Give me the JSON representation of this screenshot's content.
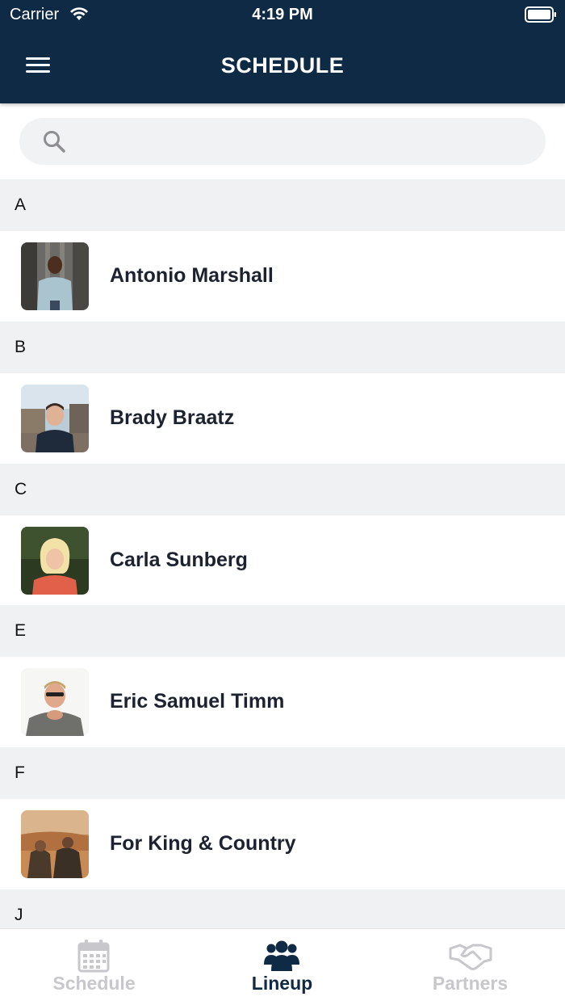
{
  "status_bar": {
    "carrier": "Carrier",
    "time": "4:19 PM"
  },
  "header": {
    "title": "SCHEDULE",
    "menu_icon": "hamburger-menu-icon"
  },
  "search": {
    "placeholder": "",
    "icon": "search-icon"
  },
  "sections": [
    {
      "letter": "A",
      "items": [
        {
          "name": "Antonio Marshall"
        }
      ]
    },
    {
      "letter": "B",
      "items": [
        {
          "name": "Brady Braatz"
        }
      ]
    },
    {
      "letter": "C",
      "items": [
        {
          "name": "Carla Sunberg"
        }
      ]
    },
    {
      "letter": "E",
      "items": [
        {
          "name": "Eric Samuel Timm"
        }
      ]
    },
    {
      "letter": "F",
      "items": [
        {
          "name": "For King & Country"
        }
      ]
    },
    {
      "letter": "J",
      "items": []
    }
  ],
  "tabs": [
    {
      "label": "Schedule",
      "icon": "calendar-icon",
      "active": false
    },
    {
      "label": "Lineup",
      "icon": "group-icon",
      "active": true
    },
    {
      "label": "Partners",
      "icon": "handshake-icon",
      "active": false
    }
  ],
  "colors": {
    "header_bg": "#0f2a44",
    "section_bg": "#f0f1f3",
    "active_tab": "#0f2a44",
    "inactive_tab": "#c7c7cc"
  }
}
